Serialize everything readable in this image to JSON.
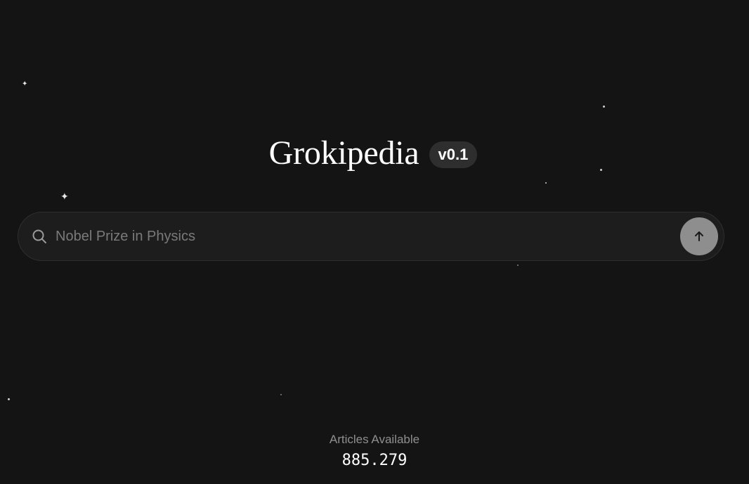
{
  "brand": {
    "title": "Grokipedia",
    "version": "v0.1"
  },
  "search": {
    "placeholder": "Nobel Prize in Physics",
    "value": "",
    "icon": "search-icon",
    "submit_icon": "arrow-up-icon"
  },
  "stats": {
    "label": "Articles Available",
    "value": "885.279"
  },
  "colors": {
    "background": "#141414",
    "search_background": "#1d1d1d",
    "badge_background": "#2e2e2e",
    "submit_button": "#8e8e8e"
  }
}
